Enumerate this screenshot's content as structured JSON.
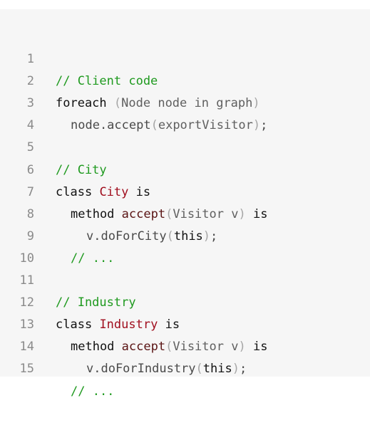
{
  "code": {
    "lines": [
      {
        "number": "1",
        "tokens": [
          {
            "text": "// Client code",
            "kind": "comment"
          }
        ]
      },
      {
        "number": "2",
        "tokens": [
          {
            "text": "foreach",
            "kind": "keyword"
          },
          {
            "text": " ",
            "kind": "plain"
          },
          {
            "text": "(",
            "kind": "punct"
          },
          {
            "text": "Node node in graph",
            "kind": "type"
          },
          {
            "text": ")",
            "kind": "punct"
          }
        ]
      },
      {
        "number": "3",
        "tokens": [
          {
            "text": "node.accept",
            "kind": "plain"
          },
          {
            "text": "(",
            "kind": "punct"
          },
          {
            "text": "exportVisitor",
            "kind": "type"
          },
          {
            "text": ")",
            "kind": "punct"
          },
          {
            "text": ";",
            "kind": "plain"
          }
        ]
      },
      {
        "number": "4",
        "tokens": []
      },
      {
        "number": "5",
        "tokens": [
          {
            "text": "// City",
            "kind": "comment"
          }
        ]
      },
      {
        "number": "6",
        "tokens": [
          {
            "text": "class",
            "kind": "keyword"
          },
          {
            "text": " ",
            "kind": "plain"
          },
          {
            "text": "City",
            "kind": "class"
          },
          {
            "text": " ",
            "kind": "plain"
          },
          {
            "text": "is",
            "kind": "keyword"
          }
        ]
      },
      {
        "number": "7",
        "tokens": [
          {
            "text": "method",
            "kind": "keyword"
          },
          {
            "text": " ",
            "kind": "plain"
          },
          {
            "text": "accept",
            "kind": "method"
          },
          {
            "text": "(",
            "kind": "punct"
          },
          {
            "text": "Visitor v",
            "kind": "type"
          },
          {
            "text": ")",
            "kind": "punct"
          },
          {
            "text": " ",
            "kind": "plain"
          },
          {
            "text": "is",
            "kind": "keyword"
          }
        ]
      },
      {
        "number": "8",
        "tokens": [
          {
            "text": "v.doForCity",
            "kind": "plain"
          },
          {
            "text": "(",
            "kind": "punct"
          },
          {
            "text": "this",
            "kind": "keyword"
          },
          {
            "text": ")",
            "kind": "punct"
          },
          {
            "text": ";",
            "kind": "plain"
          }
        ]
      },
      {
        "number": "9",
        "tokens": [
          {
            "text": "// ...",
            "kind": "comment"
          }
        ]
      },
      {
        "number": "10",
        "tokens": []
      },
      {
        "number": "11",
        "tokens": [
          {
            "text": "// Industry",
            "kind": "comment"
          }
        ]
      },
      {
        "number": "12",
        "tokens": [
          {
            "text": "class",
            "kind": "keyword"
          },
          {
            "text": " ",
            "kind": "plain"
          },
          {
            "text": "Industry",
            "kind": "class"
          },
          {
            "text": " ",
            "kind": "plain"
          },
          {
            "text": "is",
            "kind": "keyword"
          }
        ]
      },
      {
        "number": "13",
        "tokens": [
          {
            "text": "method",
            "kind": "keyword"
          },
          {
            "text": " ",
            "kind": "plain"
          },
          {
            "text": "accept",
            "kind": "method"
          },
          {
            "text": "(",
            "kind": "punct"
          },
          {
            "text": "Visitor v",
            "kind": "type"
          },
          {
            "text": ")",
            "kind": "punct"
          },
          {
            "text": " ",
            "kind": "plain"
          },
          {
            "text": "is",
            "kind": "keyword"
          }
        ]
      },
      {
        "number": "14",
        "tokens": [
          {
            "text": "v.doForIndustry",
            "kind": "plain"
          },
          {
            "text": "(",
            "kind": "punct"
          },
          {
            "text": "this",
            "kind": "keyword"
          },
          {
            "text": ")",
            "kind": "punct"
          },
          {
            "text": ";",
            "kind": "plain"
          }
        ]
      },
      {
        "number": "15",
        "tokens": [
          {
            "text": "// ...",
            "kind": "comment"
          }
        ]
      }
    ],
    "colors": {
      "background": "#f6f6f6",
      "line_number": "#8a8a8a",
      "comment": "#1f9a1f",
      "keyword": "#111111",
      "class_name": "#a00e1e",
      "method_name": "#5a1414",
      "punctuation": "#a6a6a6"
    }
  }
}
